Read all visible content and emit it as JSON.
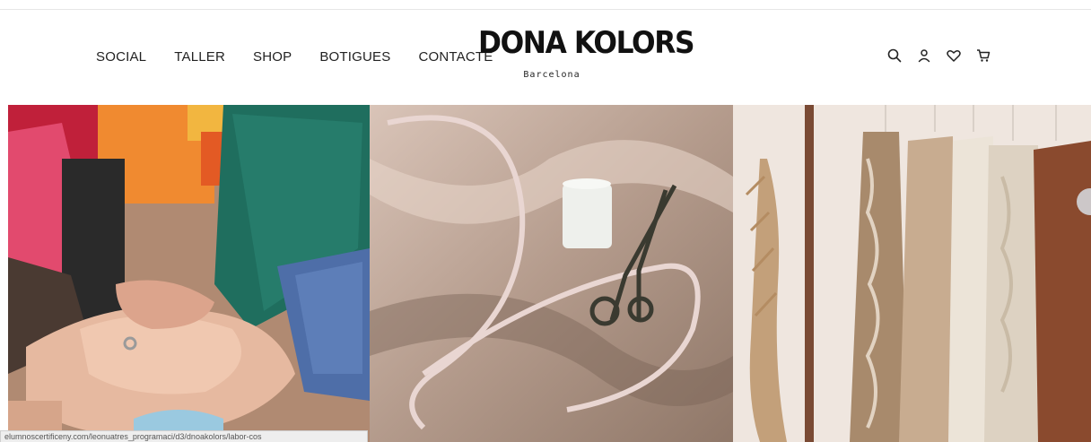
{
  "nav": {
    "items": [
      {
        "label": "SOCIAL"
      },
      {
        "label": "TALLER"
      },
      {
        "label": "SHOP"
      },
      {
        "label": "BOTIGUES"
      },
      {
        "label": "CONTACTE"
      }
    ]
  },
  "brand": {
    "name": "DONA KOLORS",
    "city": "Barcelona"
  },
  "header_icons": [
    "search-icon",
    "user-icon",
    "heart-icon",
    "cart-icon"
  ],
  "gallery": [
    {
      "subject": "hands-with-knit-sweaters"
    },
    {
      "subject": "sewing-tools-on-satin"
    },
    {
      "subject": "clothes-rack-knitwear"
    }
  ],
  "status_bar": {
    "url": "elumnoscertificeny.com/leonuatres_programaci/d3/dnoakolors/labor-cos"
  },
  "colors": {
    "text": "#222222",
    "background": "#ffffff"
  }
}
